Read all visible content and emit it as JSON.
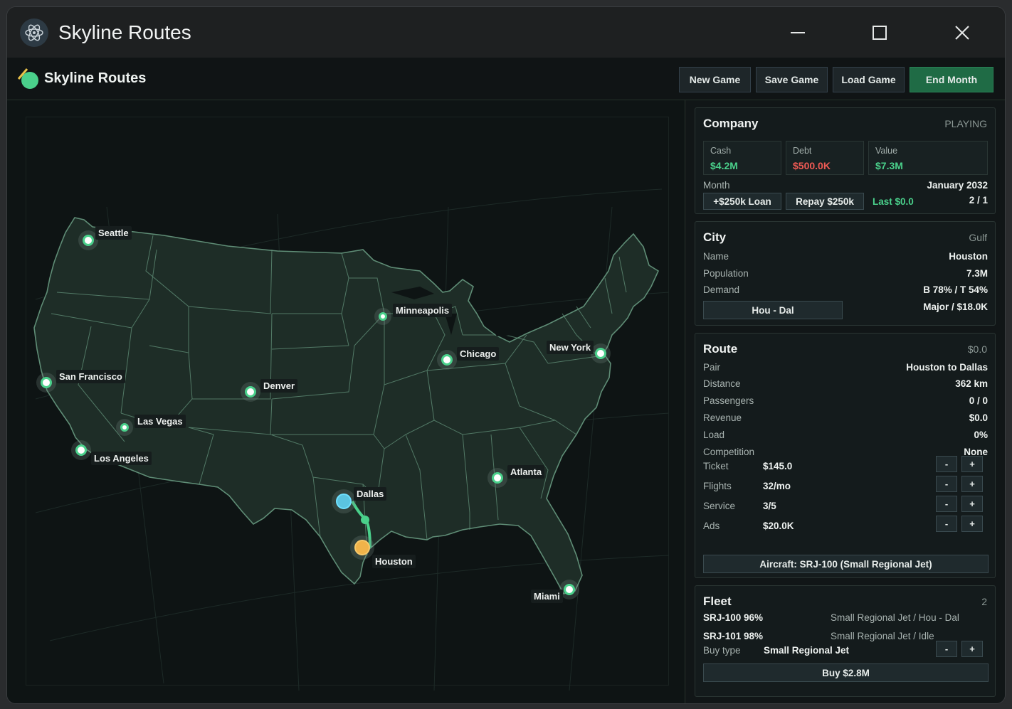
{
  "window": {
    "title": "Skyline Routes",
    "icon": "atom-icon"
  },
  "toolbar": {
    "brand": "Skyline Routes",
    "new_game": "New Game",
    "save_game": "Save Game",
    "load_game": "Load Game",
    "end_month": "End Month"
  },
  "map": {
    "cities": [
      {
        "name": "Seattle"
      },
      {
        "name": "San Francisco"
      },
      {
        "name": "Los Angeles"
      },
      {
        "name": "Las Vegas"
      },
      {
        "name": "Denver"
      },
      {
        "name": "Minneapolis"
      },
      {
        "name": "Chicago"
      },
      {
        "name": "New York"
      },
      {
        "name": "Dallas"
      },
      {
        "name": "Houston"
      },
      {
        "name": "Atlanta"
      },
      {
        "name": "Miami"
      }
    ],
    "colors": {
      "selected_origin": "#5bc4e0",
      "selected_dest": "#f0b34a",
      "route": "#4ad08b",
      "city": "#4ad08b"
    }
  },
  "company": {
    "title": "Company",
    "status": "PLAYING",
    "cash_label": "Cash",
    "cash": "$4.2M",
    "debt_label": "Debt",
    "debt": "$500.0K",
    "value_label": "Value",
    "value": "$7.3M",
    "month_label": "Month",
    "month": "January 2032",
    "loan_btn": "+$250k Loan",
    "repay_btn": "Repay $250k",
    "last": "Last $0.0",
    "counter": "2 / 1"
  },
  "city": {
    "title": "City",
    "region": "Gulf",
    "name_label": "Name",
    "name": "Houston",
    "population_label": "Population",
    "population": "7.3M",
    "demand_label": "Demand",
    "demand": "B 78% / T 54%",
    "route_btn": "Hou - Dal",
    "tier": "Major / $18.0K"
  },
  "route": {
    "title": "Route",
    "amount": "$0.0",
    "pair_label": "Pair",
    "pair": "Houston to Dallas",
    "distance_label": "Distance",
    "distance": "362 km",
    "passengers_label": "Passengers",
    "passengers": "0 / 0",
    "revenue_label": "Revenue",
    "revenue": "$0.0",
    "load_label": "Load",
    "load": "0%",
    "competition_label": "Competition",
    "competition": "None",
    "ticket_label": "Ticket",
    "ticket": "$145.0",
    "flights_label": "Flights",
    "flights": "32/mo",
    "service_label": "Service",
    "service": "3/5",
    "ads_label": "Ads",
    "ads": "$20.0K",
    "minus": "-",
    "plus": "+",
    "aircraft_btn": "Aircraft: SRJ-100 (Small Regional Jet)"
  },
  "fleet": {
    "title": "Fleet",
    "count": "2",
    "items": [
      {
        "id": "SRJ-100 96%",
        "desc": "Small Regional Jet / Hou - Dal"
      },
      {
        "id": "SRJ-101 98%",
        "desc": "Small Regional Jet / Idle"
      }
    ],
    "buy_type_label": "Buy type",
    "buy_type": "Small Regional Jet",
    "buy_btn": "Buy $2.8M"
  }
}
